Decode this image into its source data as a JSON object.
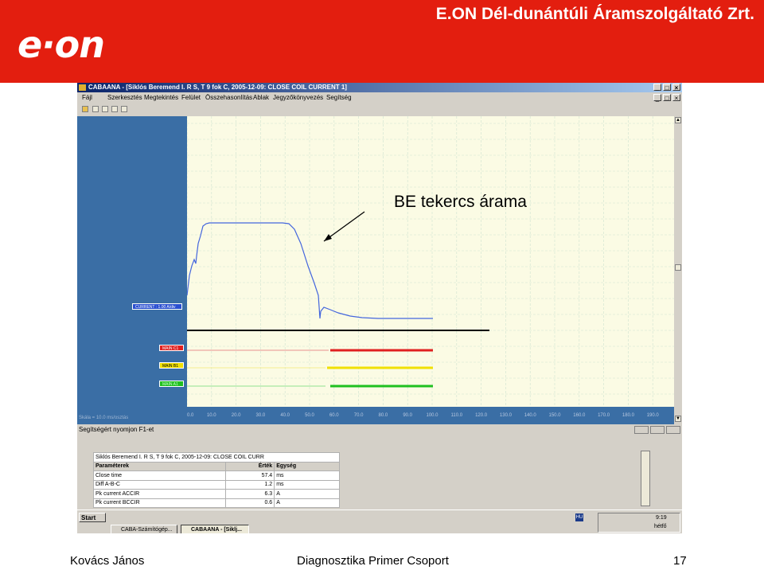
{
  "banner": {
    "logo_text": "e·on",
    "company": "E.ON Dél-dunántúli Áramszolgáltató Zrt.",
    "color": "#e31e0f"
  },
  "window": {
    "title": "CABAANA - [Siklós Beremend I. R S, T 9 fok C, 2005-12-09: CLOSE COIL CURRENT 1]",
    "buttons": [
      "_",
      "□",
      "×"
    ],
    "menu": [
      "Fájl",
      "Szerkesztés",
      "Megtekintés",
      "Felület",
      "Összehasonlítás",
      "Ablak",
      "Jegyzőkönyvezés",
      "Segítség"
    ]
  },
  "plot": {
    "annotation": "BE tekercs árama",
    "channels": [
      {
        "label": "CURRENT : 1.00 A/div",
        "color": "#3355cc"
      },
      {
        "label": "MAIN C1",
        "color": "#e02020"
      },
      {
        "label": "MAIN B1",
        "color": "#f0e000"
      },
      {
        "label": "MAIN A1",
        "color": "#20c020"
      }
    ],
    "scale_label": "Skála = 10.0 ms/osztás",
    "x_ticks": [
      "0.0",
      "10.0",
      "20.0",
      "30.0",
      "40.0",
      "50.0",
      "60.0",
      "70.0",
      "80.0",
      "90.0",
      "100.0",
      "110.0",
      "120.0",
      "130.0",
      "140.0",
      "150.0",
      "160.0",
      "170.0",
      "180.0",
      "190.0"
    ]
  },
  "helpbar": "Segítségért nyomjon F1-et",
  "params": {
    "caption": "Siklós Beremend I. R S, T 9 fok C, 2005-12-09: CLOSE COIL CURR",
    "headers": [
      "Paraméterek",
      "Érték",
      "Egység"
    ],
    "rows": [
      {
        "name": "Close time",
        "value": "57.4",
        "unit": "ms"
      },
      {
        "name": "Diff A-B-C",
        "value": "1.2",
        "unit": "ms"
      },
      {
        "name": "Pk current ACCIR",
        "value": "6.3",
        "unit": "A"
      },
      {
        "name": "Pk current BCCIR",
        "value": "0.6",
        "unit": "A"
      }
    ]
  },
  "taskbar": {
    "start": "Start",
    "tasks": [
      "CABA-Számítógép...",
      "CABAANA - [Siklj..."
    ],
    "lang": "HU",
    "time": "9:19",
    "day": "hétfő"
  },
  "footer": {
    "author": "Kovács János",
    "group": "Diagnosztika Primer Csoport",
    "page": "17"
  }
}
